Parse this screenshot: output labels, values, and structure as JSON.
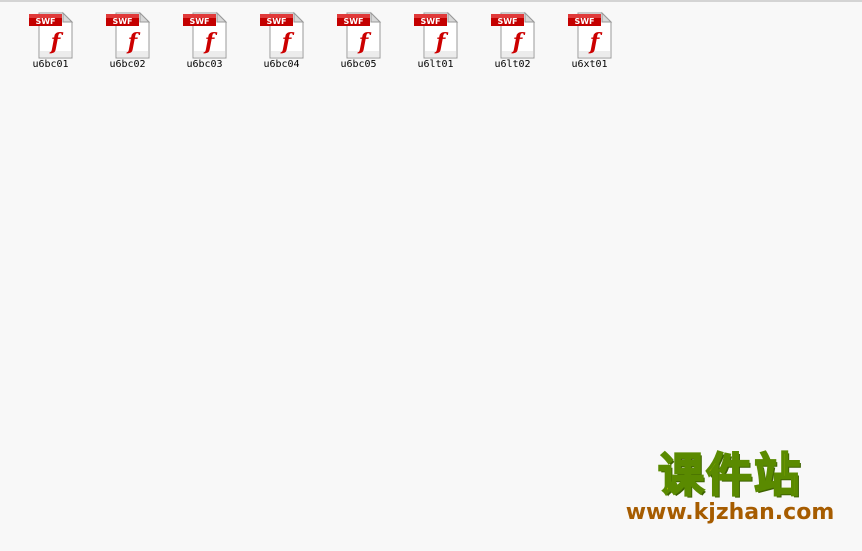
{
  "files": [
    {
      "name": "u6bc01",
      "type_badge": "SWF",
      "glyph": "f",
      "icon": "flash-swf-file-icon"
    },
    {
      "name": "u6bc02",
      "type_badge": "SWF",
      "glyph": "f",
      "icon": "flash-swf-file-icon"
    },
    {
      "name": "u6bc03",
      "type_badge": "SWF",
      "glyph": "f",
      "icon": "flash-swf-file-icon"
    },
    {
      "name": "u6bc04",
      "type_badge": "SWF",
      "glyph": "f",
      "icon": "flash-swf-file-icon"
    },
    {
      "name": "u6bc05",
      "type_badge": "SWF",
      "glyph": "f",
      "icon": "flash-swf-file-icon"
    },
    {
      "name": "u6lt01",
      "type_badge": "SWF",
      "glyph": "f",
      "icon": "flash-swf-file-icon"
    },
    {
      "name": "u6lt02",
      "type_badge": "SWF",
      "glyph": "f",
      "icon": "flash-swf-file-icon"
    },
    {
      "name": "u6xt01",
      "type_badge": "SWF",
      "glyph": "f",
      "icon": "flash-swf-file-icon"
    }
  ],
  "watermark": {
    "title": "课件站",
    "url": "www.kjzhan.com"
  },
  "colors": {
    "background": "#f8f8f8",
    "badge_red": "#c40000",
    "flash_red": "#cc0000",
    "watermark_yellow": "#ffee00",
    "watermark_green": "#5a8a00",
    "watermark_brown": "#a65c00"
  }
}
